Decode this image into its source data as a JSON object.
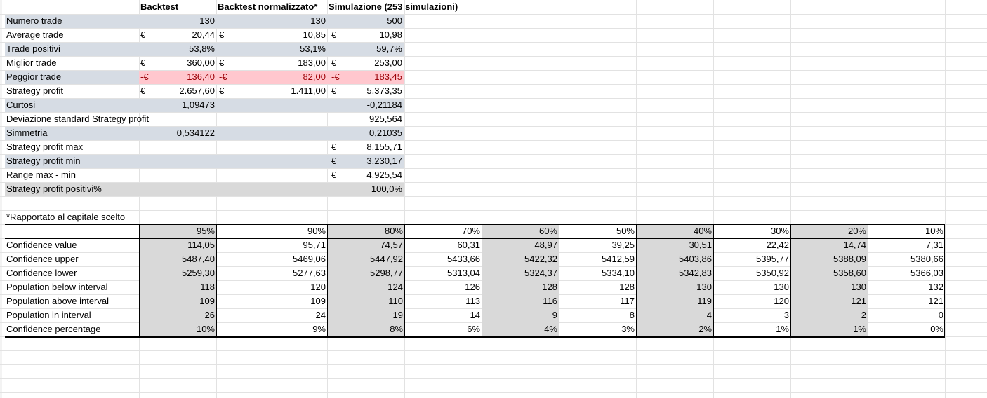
{
  "headers": {
    "backtest": "Backtest",
    "normalized": "Backtest normalizzato*",
    "simulation": "Simulazione (253 simulazioni)"
  },
  "currency": "€",
  "neg_currency": "-€",
  "summary_rows": [
    {
      "label": "Numero trade",
      "b": "130",
      "n": "130",
      "s": "500"
    },
    {
      "label": "Average trade",
      "b": "20,44",
      "n": "10,85",
      "s": "10,98"
    },
    {
      "label": "Trade positivi",
      "b": "53,8%",
      "n": "53,1%",
      "s": "59,7%"
    },
    {
      "label": "Miglior trade",
      "b": "360,00",
      "n": "183,00",
      "s": "253,00"
    },
    {
      "label": "Peggior trade",
      "b": "136,40",
      "n": "82,00",
      "s": "183,45"
    },
    {
      "label": "Strategy profit",
      "b": "2.657,60",
      "n": "1.411,00",
      "s": "5.373,35"
    },
    {
      "label": "Curtosi",
      "b": "1,09473",
      "n": "",
      "s": "-0,21184"
    },
    {
      "label": "Deviazione standard Strategy profit",
      "b": "",
      "n": "",
      "s": "925,564"
    },
    {
      "label": "Simmetria",
      "b": "0,534122",
      "n": "",
      "s": "0,21035"
    },
    {
      "label": "Strategy profit max",
      "b": "",
      "n": "",
      "s": "8.155,71"
    },
    {
      "label": "Strategy profit min",
      "b": "",
      "n": "",
      "s": "3.230,17"
    },
    {
      "label": "Range max - min",
      "b": "",
      "n": "",
      "s": "4.925,54"
    },
    {
      "label": "Strategy profit positivi%",
      "b": "",
      "n": "",
      "s": "100,0%"
    }
  ],
  "footnote": "*Rapportato al capitale scelto",
  "confidence_table": {
    "levels": [
      "95%",
      "90%",
      "80%",
      "70%",
      "60%",
      "50%",
      "40%",
      "30%",
      "20%",
      "10%"
    ],
    "rows": [
      {
        "label": "Confidence value",
        "values": [
          "114,05",
          "95,71",
          "74,57",
          "60,31",
          "48,97",
          "39,25",
          "30,51",
          "22,42",
          "14,74",
          "7,31"
        ]
      },
      {
        "label": "Confidence upper",
        "values": [
          "5487,40",
          "5469,06",
          "5447,92",
          "5433,66",
          "5422,32",
          "5412,59",
          "5403,86",
          "5395,77",
          "5388,09",
          "5380,66"
        ]
      },
      {
        "label": "Confidence lower",
        "values": [
          "5259,30",
          "5277,63",
          "5298,77",
          "5313,04",
          "5324,37",
          "5334,10",
          "5342,83",
          "5350,92",
          "5358,60",
          "5366,03"
        ]
      },
      {
        "label": "Population below interval",
        "values": [
          "118",
          "120",
          "124",
          "126",
          "128",
          "128",
          "130",
          "130",
          "130",
          "132"
        ]
      },
      {
        "label": "Population above interval",
        "values": [
          "109",
          "109",
          "110",
          "113",
          "116",
          "117",
          "119",
          "120",
          "121",
          "121"
        ]
      },
      {
        "label": "Population in interval",
        "values": [
          "26",
          "24",
          "19",
          "14",
          "9",
          "8",
          "4",
          "3",
          "2",
          "0"
        ]
      },
      {
        "label": "Confidence percentage",
        "values": [
          "10%",
          "9%",
          "8%",
          "6%",
          "4%",
          "3%",
          "2%",
          "1%",
          "1%",
          "0%"
        ]
      }
    ]
  },
  "colors": {
    "band_blue": "#d6dce4",
    "band_grey": "#d9d9d9",
    "bad_fill": "#ffc7ce",
    "bad_text": "#9c0006",
    "gridline": "#e2e2e2"
  }
}
